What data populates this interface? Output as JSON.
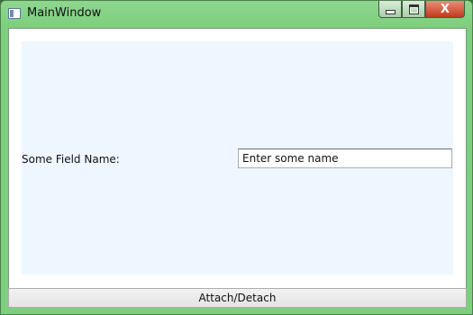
{
  "window": {
    "title": "MainWindow",
    "caption_buttons": {
      "minimize_icon": "minimize-icon",
      "maximize_icon": "maximize-icon",
      "close_glyph": "X"
    }
  },
  "form": {
    "field_label": "Some Field Name:",
    "field_value": "Enter some name",
    "panel_color": "#eef7ff"
  },
  "footer": {
    "button_label": "Attach/Detach"
  },
  "colors": {
    "frame": "#7ccf7c",
    "close": "#c43a1c"
  }
}
